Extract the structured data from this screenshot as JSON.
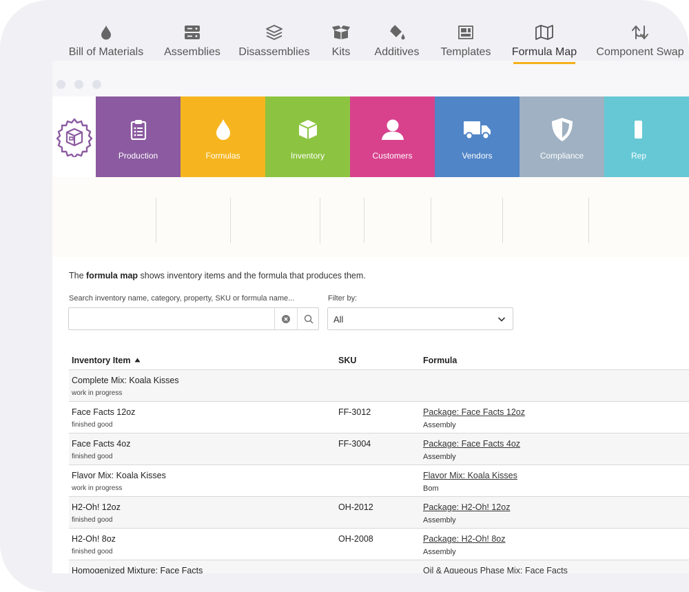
{
  "main_nav": {
    "colors": {
      "production": "#8b5aa0",
      "formulas": "#f6b51f",
      "inventory": "#8cc441",
      "customers": "#d8428d",
      "vendors": "#5085c7",
      "compliance": "#9fb1c2",
      "reports": "#65c8d4",
      "logo": "#8b5aa0"
    },
    "items": [
      {
        "label": "Production",
        "icon": "clipboard-icon"
      },
      {
        "label": "Formulas",
        "icon": "droplet-icon"
      },
      {
        "label": "Inventory",
        "icon": "box-icon"
      },
      {
        "label": "Customers",
        "icon": "user-icon"
      },
      {
        "label": "Vendors",
        "icon": "truck-icon"
      },
      {
        "label": "Compliance",
        "icon": "shield-icon"
      },
      {
        "label": "Rep",
        "icon": "report-icon"
      }
    ]
  },
  "sub_nav": {
    "accent": "#f5b01a",
    "items": [
      {
        "label": "Bill of Materials",
        "icon": "droplet-icon"
      },
      {
        "label": "Assemblies",
        "icon": "server-icon"
      },
      {
        "label": "Disassemblies",
        "icon": "layers-icon"
      },
      {
        "label": "Kits",
        "icon": "kit-box-icon"
      },
      {
        "label": "Additives",
        "icon": "paint-bucket-icon"
      },
      {
        "label": "Templates",
        "icon": "template-icon"
      },
      {
        "label": "Formula Map",
        "icon": "map-icon",
        "active": true
      },
      {
        "label": "Component Swap",
        "icon": "swap-arrows-icon"
      }
    ]
  },
  "intro": {
    "prefix": "The ",
    "bold": "formula map",
    "suffix": " shows inventory items and the formula that produces them."
  },
  "search": {
    "label": "Search inventory name, category, property, SKU or formula name...",
    "value": "",
    "placeholder": ""
  },
  "filter": {
    "label": "Filter by:",
    "value": "All"
  },
  "table": {
    "headers": {
      "item": "Inventory Item",
      "sku": "SKU",
      "formula": "Formula"
    },
    "rows": [
      {
        "name": "Complete Mix: Koala Kisses",
        "type": "work in progress",
        "sku": "",
        "formula": "",
        "formula_type": ""
      },
      {
        "name": "Face Facts 12oz",
        "type": "finished good",
        "sku": "FF-3012",
        "formula": "Package: Face Facts 12oz",
        "formula_type": "Assembly"
      },
      {
        "name": "Face Facts 4oz",
        "type": "finished good",
        "sku": "FF-3004",
        "formula": "Package: Face Facts 4oz",
        "formula_type": "Assembly"
      },
      {
        "name": "Flavor Mix: Koala Kisses",
        "type": "work in progress",
        "sku": "",
        "formula": "Flavor Mix: Koala Kisses",
        "formula_type": "Bom"
      },
      {
        "name": "H2-Oh! 12oz",
        "type": "finished good",
        "sku": "OH-2012",
        "formula": "Package: H2-Oh! 12oz",
        "formula_type": "Assembly"
      },
      {
        "name": "H2-Oh! 8oz",
        "type": "finished good",
        "sku": "OH-2008",
        "formula": "Package: H2-Oh! 8oz",
        "formula_type": "Assembly"
      },
      {
        "name": "Homogenized Mixture: Face Facts",
        "type": "",
        "sku": "",
        "formula": "Oil & Aqueous Phase Mix: Face Facts",
        "formula_type": ""
      }
    ]
  }
}
